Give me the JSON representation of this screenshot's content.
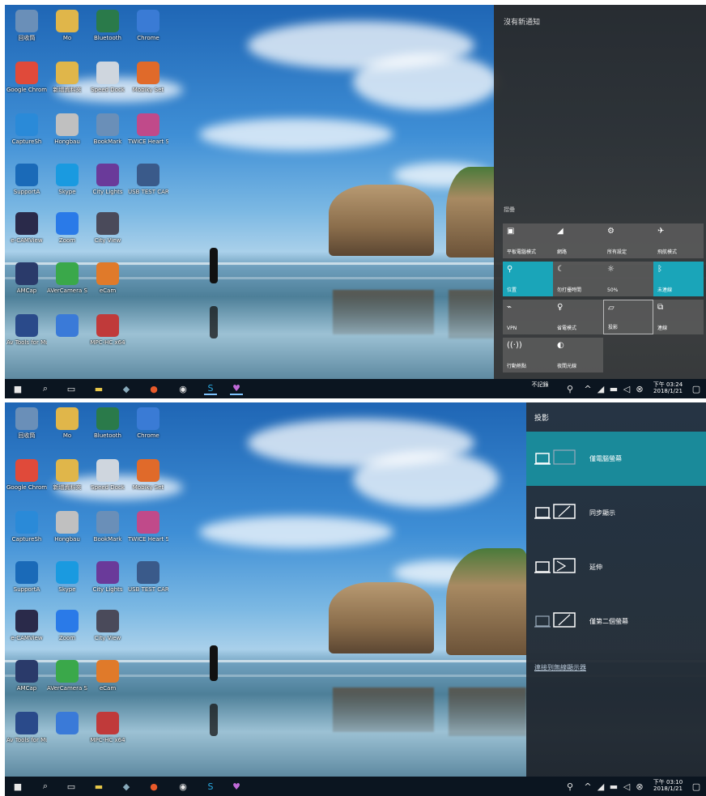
{
  "top_screen": {
    "desktop_icons": [
      {
        "label": "回收筒",
        "icon": "recycle-bin-icon",
        "color": "#6a8fb8"
      },
      {
        "label": "Mo",
        "icon": "folder-icon",
        "color": "#e0b64a"
      },
      {
        "label": "Bluetooth",
        "icon": "wifi-icon",
        "color": "#2a7a4a"
      },
      {
        "label": "Chrome",
        "icon": "window-icon",
        "color": "#3a7bd5"
      },
      {
        "label": "Google Chrome",
        "icon": "chrome-icon",
        "color": "#e04a3a"
      },
      {
        "label": "新增資料夾",
        "icon": "folder-icon",
        "color": "#e0b64a"
      },
      {
        "label": "Speed Dock",
        "icon": "app-icon",
        "color": "#cfd6de"
      },
      {
        "label": "Mobiky Set",
        "icon": "app-icon",
        "color": "#e06a2a"
      },
      {
        "label": "CaptureSh",
        "icon": "capture-icon",
        "color": "#2a8ad8"
      },
      {
        "label": "Hongbau",
        "icon": "app-icon",
        "color": "#c0c0c0"
      },
      {
        "label": "BookMark",
        "icon": "app-icon",
        "color": "#6a8fb8"
      },
      {
        "label": "TWICE Heart Shaker MV",
        "icon": "video-icon",
        "color": "#c04a8a"
      },
      {
        "label": "SupportA",
        "icon": "support-icon",
        "color": "#1a6ab8"
      },
      {
        "label": "Skype",
        "icon": "skype-icon",
        "color": "#1a9ae0"
      },
      {
        "label": "City Lights",
        "icon": "image-icon",
        "color": "#6a3a9a"
      },
      {
        "label": "USB TEST CARD",
        "icon": "camera-icon",
        "color": "#3a5a8a"
      },
      {
        "label": "e-CAMView",
        "icon": "camera-icon",
        "color": "#2a2a4a"
      },
      {
        "label": "Zoom",
        "icon": "zoom-icon",
        "color": "#2a7ae8"
      },
      {
        "label": "City View",
        "icon": "image-icon",
        "color": "#4a4a5a"
      },
      {
        "label": "AMCap",
        "icon": "camera-icon",
        "color": "#2a3a6a"
      },
      {
        "label": "AVerCamera Setting Tool",
        "icon": "gear-icon",
        "color": "#3aa84a"
      },
      {
        "label": "eCam",
        "icon": "camera-icon",
        "color": "#e07a2a"
      },
      {
        "label": "Av Tools for Multi Sensor",
        "icon": "app-icon",
        "color": "#2a4a8a"
      },
      {
        "label": "",
        "icon": "app-icon",
        "color": "#3a7ad8"
      },
      {
        "label": "MPC-HC x64",
        "icon": "media-icon",
        "color": "#c03a3a"
      }
    ],
    "action_center": {
      "title": "沒有新通知",
      "collapse_label": "摺疊",
      "tiles": [
        {
          "icon": "tablet-mode-icon",
          "label": "平板電腦模式",
          "on": false
        },
        {
          "icon": "network-icon",
          "label": "網路",
          "on": false
        },
        {
          "icon": "settings-icon",
          "label": "所有設定",
          "on": false
        },
        {
          "icon": "airplane-icon",
          "label": "飛航模式",
          "on": false
        },
        {
          "icon": "location-icon",
          "label": "位置",
          "on": true
        },
        {
          "icon": "focus-assist-icon",
          "label": "勿打擾時間",
          "on": false
        },
        {
          "icon": "brightness-icon",
          "label": "50%",
          "on": false
        },
        {
          "icon": "bluetooth-icon",
          "label": "未連線",
          "on": true
        },
        {
          "icon": "vpn-icon",
          "label": "VPN",
          "on": false
        },
        {
          "icon": "battery-saver-icon",
          "label": "省電模式",
          "on": false
        },
        {
          "icon": "project-icon",
          "label": "投影",
          "on": false,
          "focus": true
        },
        {
          "icon": "connect-icon",
          "label": "連線",
          "on": false
        },
        {
          "icon": "mobile-hotspot-icon",
          "label": "行動熱點",
          "on": false
        },
        {
          "icon": "night-light-icon",
          "label": "夜間光線",
          "on": false
        }
      ]
    },
    "taskbar": {
      "time": "下午 03:24",
      "date": "2018/1/21",
      "tray_label": "不記錄"
    }
  },
  "bottom_screen": {
    "project_panel": {
      "title": "投影",
      "options": [
        {
          "label": "僅電腦螢幕",
          "selected": true
        },
        {
          "label": "同步顯示",
          "selected": false
        },
        {
          "label": "延伸",
          "selected": false
        },
        {
          "label": "僅第二個螢幕",
          "selected": false
        }
      ],
      "link": "連接到無線顯示器"
    },
    "taskbar": {
      "time": "下午 03:10",
      "date": "2018/1/21"
    }
  },
  "colors": {
    "accent": "#1aa5b9",
    "taskbar": "#0b1520"
  }
}
